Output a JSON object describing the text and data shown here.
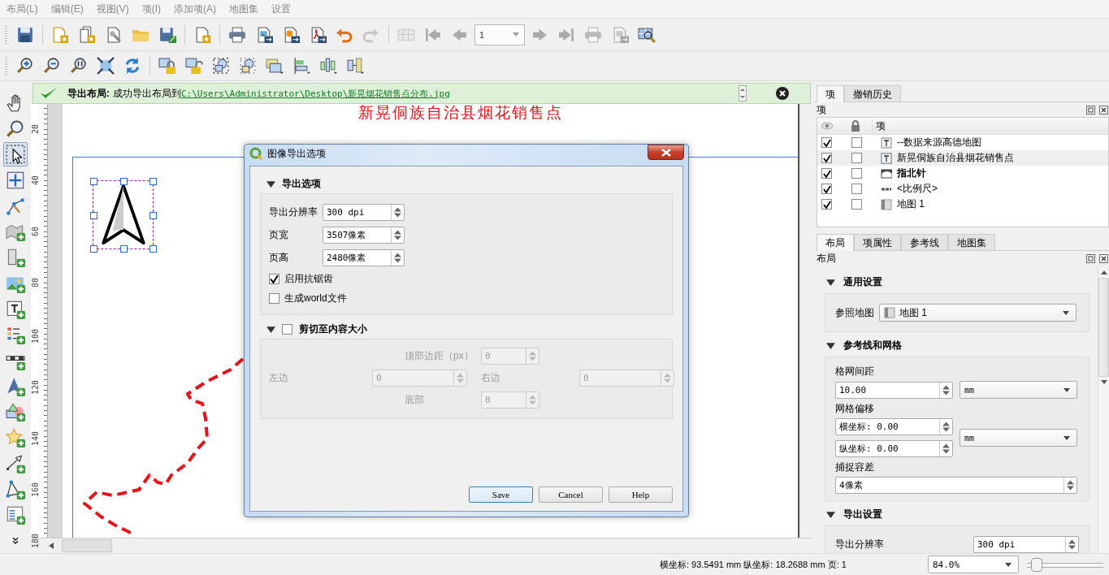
{
  "menu": [
    {
      "label": "布局(L)"
    },
    {
      "label": "编辑(E)"
    },
    {
      "label": "视图(V)"
    },
    {
      "label": "项(I)"
    },
    {
      "label": "添加项(A)"
    },
    {
      "label": "地图集"
    },
    {
      "label": "设置"
    }
  ],
  "toolbar_1": [
    [
      {
        "kind": "save",
        "disabled": false
      }
    ],
    [
      {
        "kind": "new-layout",
        "disabled": false
      },
      {
        "kind": "duplicate-layout",
        "disabled": false
      },
      {
        "kind": "layout-manager",
        "disabled": false
      },
      {
        "kind": "open-template",
        "disabled": false
      },
      {
        "kind": "save-template",
        "disabled": false
      }
    ],
    [
      {
        "kind": "add-pages",
        "disabled": false
      }
    ],
    [
      {
        "kind": "print",
        "disabled": false
      },
      {
        "kind": "export-image",
        "disabled": false
      },
      {
        "kind": "export-svg",
        "disabled": false
      },
      {
        "kind": "export-pdf",
        "disabled": false
      },
      {
        "kind": "undo",
        "disabled": false
      },
      {
        "kind": "redo",
        "disabled": true
      }
    ],
    [
      {
        "kind": "atlas-preview",
        "disabled": true
      },
      {
        "kind": "first",
        "disabled": true
      },
      {
        "kind": "previous",
        "disabled": true
      },
      {
        "kind": "page-field",
        "value": "1",
        "disabled": true
      },
      {
        "kind": "next",
        "disabled": true
      },
      {
        "kind": "last",
        "disabled": true
      },
      {
        "kind": "print",
        "disabled": true
      },
      {
        "kind": "export-image-menu",
        "disabled": true
      },
      {
        "kind": "atlas-settings",
        "disabled": false
      }
    ]
  ],
  "toolbar_2": [
    [
      {
        "kind": "zoom-in",
        "disabled": false
      },
      {
        "kind": "zoom-out",
        "disabled": false
      },
      {
        "kind": "zoom-actual",
        "disabled": false
      },
      {
        "kind": "zoom-full",
        "disabled": false
      },
      {
        "kind": "refresh",
        "disabled": false
      }
    ],
    [
      {
        "kind": "lock",
        "disabled": false
      },
      {
        "kind": "unlock",
        "disabled": false
      },
      {
        "kind": "group",
        "disabled": false
      },
      {
        "kind": "ungroup",
        "disabled": false
      },
      {
        "kind": "raise",
        "disabled": false
      },
      {
        "kind": "align",
        "disabled": false
      },
      {
        "kind": "distribute",
        "disabled": false
      },
      {
        "kind": "resize",
        "disabled": false
      }
    ]
  ],
  "toolbox": [
    {
      "kind": "pan",
      "selected": false
    },
    {
      "kind": "zoom",
      "selected": false
    },
    {
      "kind": "select",
      "selected": true
    },
    {
      "kind": "move-content",
      "selected": false
    },
    {
      "kind": "edit-nodes",
      "selected": false
    },
    {
      "kind": "add-map",
      "selected": false
    },
    {
      "kind": "add-3d-map",
      "selected": false
    },
    {
      "kind": "add-picture",
      "selected": false
    },
    {
      "kind": "add-label",
      "selected": false
    },
    {
      "kind": "add-legend",
      "selected": false
    },
    {
      "kind": "add-scalebar",
      "selected": false
    },
    {
      "kind": "add-north-arrow",
      "selected": false
    },
    {
      "kind": "add-shape",
      "selected": false
    },
    {
      "kind": "add-marker",
      "selected": false
    },
    {
      "kind": "add-arrow",
      "selected": false
    },
    {
      "kind": "add-node-item",
      "selected": false
    },
    {
      "kind": "add-html",
      "selected": false
    },
    {
      "kind": "more",
      "selected": false
    }
  ],
  "message_bar": {
    "title": "导出布局:",
    "text": "成功导出布局到",
    "link": "C:\\Users\\Administrator\\Desktop\\新晃烟花销售点分布.jpg"
  },
  "ruler": {
    "labels": [
      "20",
      "40",
      "60",
      "80",
      "100",
      "120",
      "140",
      "160",
      "180"
    ]
  },
  "layout_page": {
    "title": "新晃侗族自治县烟花销售点"
  },
  "dialog": {
    "title": "图像导出选项",
    "export_section": {
      "title": "导出选项",
      "expanded": true,
      "fields": [
        {
          "label": "导出分辨率",
          "value": "300 dpi"
        },
        {
          "label": "页宽",
          "value": "3507像素"
        },
        {
          "label": "页高",
          "value": "2480像素"
        }
      ],
      "checkboxes": [
        {
          "label": "启用抗锯齿",
          "checked": true
        },
        {
          "label": "生成world文件",
          "checked": false
        }
      ]
    },
    "crop_section": {
      "title": "剪切至内容大小",
      "expanded": true,
      "checked": false,
      "disabled": true,
      "top": {
        "label": "顶部边距（px）",
        "value": "0"
      },
      "left": {
        "label": "左边",
        "value": "0"
      },
      "right": {
        "label": "右边",
        "value": "0"
      },
      "bottom": {
        "label": "底部",
        "value": "0"
      }
    },
    "buttons": [
      {
        "label": "Save",
        "default": true
      },
      {
        "label": "Cancel",
        "default": false
      },
      {
        "label": "Help",
        "default": false
      }
    ]
  },
  "items_panel": {
    "tabs": [
      {
        "label": "项",
        "selected": true
      },
      {
        "label": "撤销历史",
        "selected": false
      }
    ],
    "title": "项",
    "column": "项",
    "rows": [
      {
        "kind": "text",
        "label": "--数据来源高德地图",
        "visible": true,
        "locked": false,
        "selected": false,
        "current": false
      },
      {
        "kind": "text",
        "label": "新晃侗族自治县烟花销售点",
        "visible": true,
        "locked": false,
        "selected": true,
        "current": false
      },
      {
        "kind": "picture",
        "label": "指北针",
        "visible": true,
        "locked": false,
        "selected": false,
        "current": true
      },
      {
        "kind": "scalebar",
        "label": "<比例尺>",
        "visible": true,
        "locked": false,
        "selected": false,
        "current": false
      },
      {
        "kind": "map",
        "label": "地图 1",
        "visible": true,
        "locked": false,
        "selected": false,
        "current": false
      }
    ]
  },
  "layout_panel": {
    "tabs": [
      {
        "label": "布局",
        "selected": true
      },
      {
        "label": "项属性",
        "selected": false
      },
      {
        "label": "参考线",
        "selected": false
      },
      {
        "label": "地图集",
        "selected": false
      }
    ],
    "title": "布局",
    "general": {
      "title": "通用设置",
      "expanded": true,
      "reference_map_label": "参照地图",
      "reference_map": "地图 1"
    },
    "guides": {
      "title": "参考线和网格",
      "expanded": true,
      "spacing_label": "格网间距",
      "spacing": "10.00",
      "spacing_unit": "mm",
      "offset_label": "网格偏移",
      "offset_x": "横坐标: 0.00",
      "offset_y": "纵坐标: 0.00",
      "offset_unit": "mm",
      "snap_label": "捕捉容差",
      "snap": "4像素"
    },
    "export": {
      "title": "导出设置",
      "expanded": true,
      "resolution_label": "导出分辨率",
      "resolution": "300 dpi"
    }
  },
  "status_bar": {
    "coordinates": "横坐标: 93.5491 mm 纵坐标: 18.2688 mm 页: 1",
    "zoom": "84.0%",
    "zoom_slider": {
      "level": 0.05
    }
  }
}
